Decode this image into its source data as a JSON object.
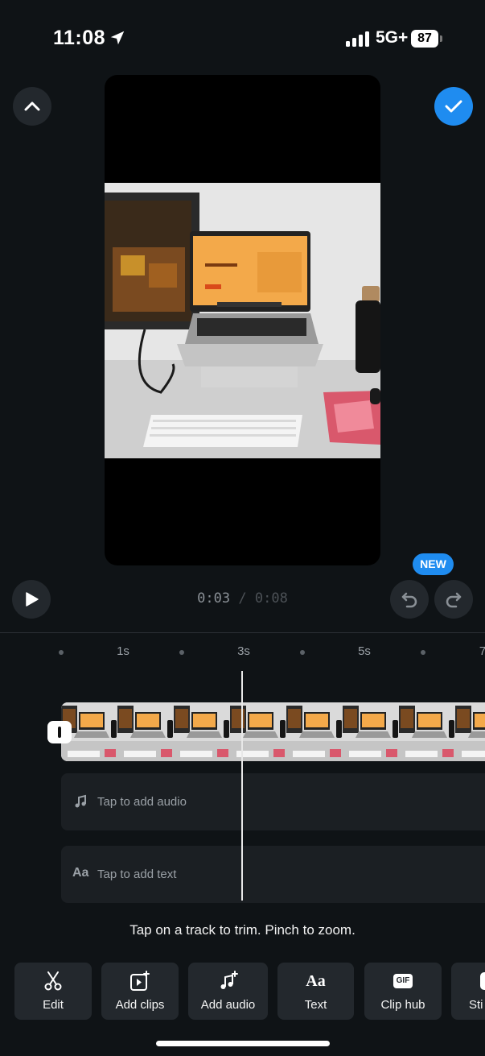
{
  "status_bar": {
    "time": "11:08",
    "network": "5G+",
    "battery": "87"
  },
  "player": {
    "current_time": "0:03",
    "separator": "/",
    "total_time": "0:08",
    "new_badge": "NEW"
  },
  "timeline": {
    "ruler_labels": [
      "1s",
      "3s",
      "5s",
      "7"
    ],
    "audio_track_label": "Tap to add audio",
    "text_track_label": "Tap to add text",
    "text_track_icon": "Aa",
    "hint": "Tap on a track to trim. Pinch to zoom."
  },
  "toolbar": {
    "items": [
      {
        "label": "Edit",
        "icon": "scissors-icon"
      },
      {
        "label": "Add clips",
        "icon": "add-clip-icon"
      },
      {
        "label": "Add audio",
        "icon": "add-music-icon"
      },
      {
        "label": "Text",
        "icon": "text-icon",
        "glyph": "Aa"
      },
      {
        "label": "Clip hub",
        "icon": "gif-icon",
        "glyph": "GIF"
      },
      {
        "label": "Sti",
        "icon": "sticker-icon"
      }
    ]
  },
  "colors": {
    "background": "#0f1316",
    "button": "#23282d",
    "accent": "#1f8cf0"
  }
}
